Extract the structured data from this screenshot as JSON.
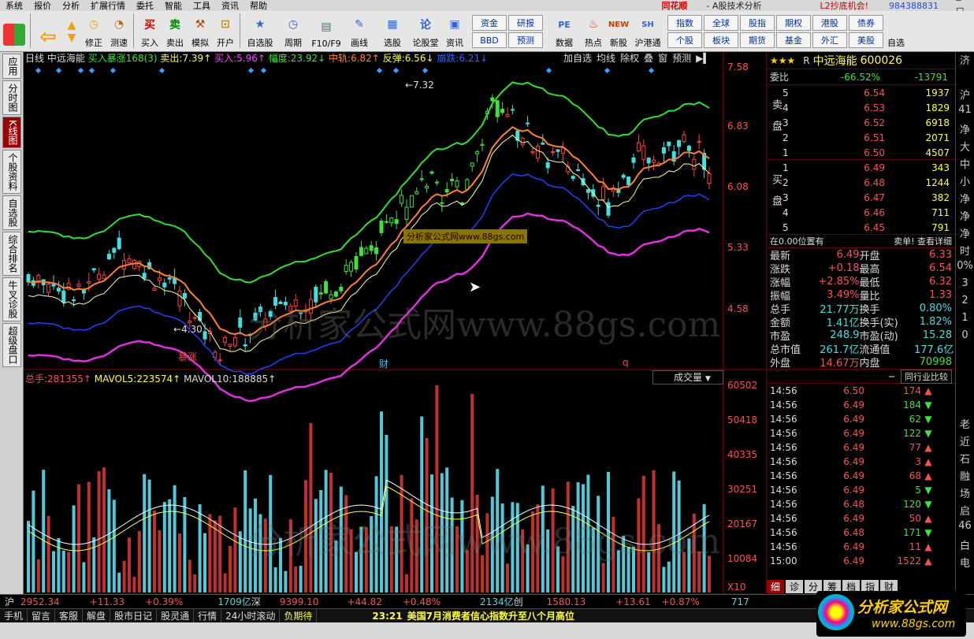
{
  "menu": {
    "items": [
      "系统",
      "报价",
      "分析",
      "扩展行情",
      "委托",
      "智能",
      "工具",
      "资讯",
      "帮助"
    ],
    "app_name": "同花顺",
    "title": "- A股技术分析",
    "account": "L2抄底机会!",
    "number": "984388831"
  },
  "toolbar": {
    "buttons": [
      {
        "label": "修正",
        "icon": "refresh-icon"
      },
      {
        "label": "测速",
        "icon": "clock-icon"
      },
      {
        "label": "买入",
        "icon": "buy-icon",
        "glyph": "买"
      },
      {
        "label": "卖出",
        "icon": "sell-icon",
        "glyph": "卖"
      },
      {
        "label": "模拟",
        "icon": "hammer-icon"
      },
      {
        "label": "开户",
        "icon": "lock-icon"
      },
      {
        "label": "自选股",
        "icon": "star-icon"
      },
      {
        "label": "周期",
        "icon": "clock-icon"
      },
      {
        "label": "F10/F9",
        "icon": "doc-icon"
      },
      {
        "label": "画线",
        "icon": "pen-icon"
      },
      {
        "label": "选股",
        "icon": "chart-icon"
      },
      {
        "label": "论股堂",
        "icon": "talk-icon",
        "glyph": "论"
      },
      {
        "label": "资讯",
        "icon": "news-icon"
      },
      {
        "label": "数据",
        "icon": "data-icon",
        "glyph": "PE"
      },
      {
        "label": "热点",
        "icon": "fire-icon"
      },
      {
        "label": "新股",
        "icon": "new-icon"
      },
      {
        "label": "沪港通",
        "icon": "hk-icon"
      }
    ],
    "grid_left": [
      "资金",
      "研报",
      "BBD",
      "预测"
    ],
    "grid_right": [
      "指数",
      "全球",
      "股指",
      "期权",
      "港股",
      "债券",
      "个股",
      "板块",
      "期货",
      "基金",
      "外汇",
      "美股"
    ],
    "end_label": "自选"
  },
  "side_tabs": [
    "应用",
    "分时图",
    "K线图",
    "个股资料",
    "自选股",
    "综合排名",
    "牛叉诊股",
    "超级盘口"
  ],
  "chart": {
    "period": "日线",
    "stock": "中远海能",
    "signal": "买入暴涨168(3)",
    "sell_label": "卖出:",
    "sell_val": "7.39↑",
    "buy_label": "买入:",
    "buy_val": "5.96↑",
    "amp_label": "幅度:",
    "amp_val": "23.92↓",
    "mid_label": "中轨:",
    "mid_val": "6.82↑",
    "rebound_label": "反弹:",
    "rebound_val": "6.56↓",
    "crash_label": "崩跌:",
    "crash_val": "6.21↓",
    "topbtns": [
      "加自选",
      "均线",
      "除权",
      "叠",
      "窗",
      "预测"
    ],
    "price_ticks": [
      "7.58",
      "6.83",
      "6.08",
      "5.33",
      "4.58"
    ],
    "hi_label": "7.32",
    "lo_label": "4.30",
    "baozhang": "暴涨",
    "cai": "财",
    "q": "q",
    "watermark": "分析家公式网www.88gs.com",
    "badge": "分析家公式网www.88gs.com",
    "vol_total_label": "总手:",
    "vol_total": "281355↑",
    "mavol5_label": "MAVOL5:",
    "mavol5": "223574↑",
    "mavol10_label": "MAVOL10:",
    "mavol10": "188885↑",
    "vol_select": "成交量",
    "vol_ticks": [
      "60502",
      "50418",
      "40335",
      "30251",
      "20167",
      "10084"
    ],
    "x10": "X10"
  },
  "chart_data": {
    "type": "candlestick",
    "ylim": [
      4.3,
      7.58
    ],
    "high": 7.32,
    "low": 4.3,
    "vol_ylim": [
      0,
      60502
    ]
  },
  "rp": {
    "stars": "★★★",
    "r": "R",
    "name": "中远海能",
    "code": "600026",
    "wb_label": "委比",
    "wb_val": "-66.52%",
    "wb_num": "-13791",
    "sell_side": "卖盘",
    "buy_side": "买盘",
    "asks": [
      [
        "5",
        "6.54",
        "1937"
      ],
      [
        "4",
        "6.53",
        "1829"
      ],
      [
        "3",
        "6.52",
        "6918"
      ],
      [
        "2",
        "6.51",
        "2071"
      ],
      [
        "1",
        "6.50",
        "4507"
      ]
    ],
    "bids": [
      [
        "1",
        "6.49",
        "343"
      ],
      [
        "2",
        "6.48",
        "1244"
      ],
      [
        "3",
        "6.47",
        "382"
      ],
      [
        "4",
        "6.46",
        "711"
      ],
      [
        "5",
        "6.45",
        "791"
      ]
    ],
    "pos_label": "在0.00位置有",
    "pos_right": "卖单! 查看详细",
    "stats": [
      [
        "最新",
        "6.49",
        "开盘",
        "6.33"
      ],
      [
        "涨跌",
        "+0.18",
        "最高",
        "6.54"
      ],
      [
        "涨幅",
        "+2.85%",
        "最低",
        "6.32"
      ],
      [
        "振幅",
        "3.49%",
        "量比",
        "1.33"
      ],
      [
        "总手",
        "21.77万",
        "换手",
        "0.80%"
      ],
      [
        "金额",
        "1.41亿",
        "换手(实)",
        "1.82%"
      ],
      [
        "市盈",
        "248.9",
        "市盈(动)",
        "15.28"
      ],
      [
        "总市值",
        "261.7亿",
        "流通值",
        "177.6亿"
      ],
      [
        "外盘",
        "14.67万",
        "内盘",
        "70998"
      ]
    ],
    "compare_btn": "同行业比较",
    "ticks": [
      [
        "14:56",
        "6.50",
        "174",
        "up"
      ],
      [
        "14:56",
        "6.49",
        "184",
        "dn"
      ],
      [
        "14:56",
        "6.49",
        "62",
        "dn"
      ],
      [
        "14:56",
        "6.49",
        "122",
        "dn"
      ],
      [
        "14:56",
        "6.49",
        "77",
        "up"
      ],
      [
        "14:56",
        "6.49",
        "3",
        "up"
      ],
      [
        "14:56",
        "6.49",
        "68",
        "up"
      ],
      [
        "14:56",
        "6.49",
        "5",
        "dn"
      ],
      [
        "14:56",
        "6.48",
        "120",
        "dn"
      ],
      [
        "14:56",
        "6.49",
        "50",
        "up"
      ],
      [
        "14:56",
        "6.48",
        "171",
        "dn"
      ],
      [
        "14:56",
        "6.49",
        "11",
        "up"
      ],
      [
        "15:00",
        "6.49",
        "1522",
        "up"
      ]
    ],
    "bottom_tabs": [
      "细",
      "诊",
      "分",
      "筹",
      "档",
      "指",
      "财"
    ]
  },
  "farright": [
    "济",
    "",
    "沪",
    "41",
    "净",
    "大",
    "中",
    "小",
    "净",
    "净",
    "净",
    "时",
    "0%",
    "3",
    "2",
    "1",
    "0",
    "",
    "",
    "",
    "",
    "老",
    "近",
    "石",
    "融",
    "场",
    "启",
    "46",
    "白",
    "电"
  ],
  "status": {
    "sh_label": "沪",
    "sh": "2952.34",
    "sh_chg": "+11.33",
    "sh_pct": "+0.39%",
    "sh_amt": "1709亿",
    "sz_label": "深",
    "sz": "9399.10",
    "sz_chg": "+44.82",
    "sz_pct": "+0.48%",
    "sz_amt": "2134亿",
    "cy_label": "创",
    "cy": "1580.13",
    "cy_chg": "+13.61",
    "cy_pct": "+0.87%",
    "last": "717"
  },
  "bottombar": {
    "items": [
      "手机",
      "留言",
      "客服",
      "解盘",
      "股市日记",
      "股灵通",
      "行情",
      "24小时滚动",
      "负期待"
    ],
    "news_time": "23:21",
    "news": "美国7月消费者信心指数升至八个月高位"
  },
  "logo": {
    "text": "分析家公式网",
    "url": "www.88gs.com"
  }
}
